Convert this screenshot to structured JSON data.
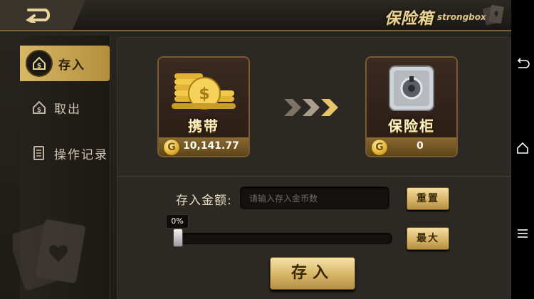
{
  "topbar": {
    "title_cn": "保险箱",
    "title_en": "strongbox"
  },
  "sidebar": {
    "items": [
      {
        "label": "存入",
        "icon": "deposit-icon",
        "active": true
      },
      {
        "label": "取出",
        "icon": "withdraw-icon",
        "active": false
      },
      {
        "label": "操作记录",
        "icon": "record-icon",
        "active": false
      }
    ]
  },
  "carry": {
    "caption": "携带",
    "value": "10,141.77",
    "icon": "gold-coins-icon"
  },
  "safe": {
    "caption": "保险柜",
    "value": "0",
    "icon": "safe-icon"
  },
  "coin_symbol": "G",
  "form": {
    "amount_label": "存入金额:",
    "amount_placeholder": "请输入存入金币数",
    "amount_value": "",
    "reset_label": "重置",
    "max_label": "最大",
    "percent_text": "0%",
    "slider_level": 0,
    "deposit_label": "存入"
  },
  "navbar": {
    "icons": [
      "back-nav-icon",
      "home-nav-icon",
      "menu-nav-icon"
    ]
  },
  "colors": {
    "accent_gold": "#d5b164",
    "panel_bg": "#2c2924",
    "brand_text": "#e8d49a"
  }
}
